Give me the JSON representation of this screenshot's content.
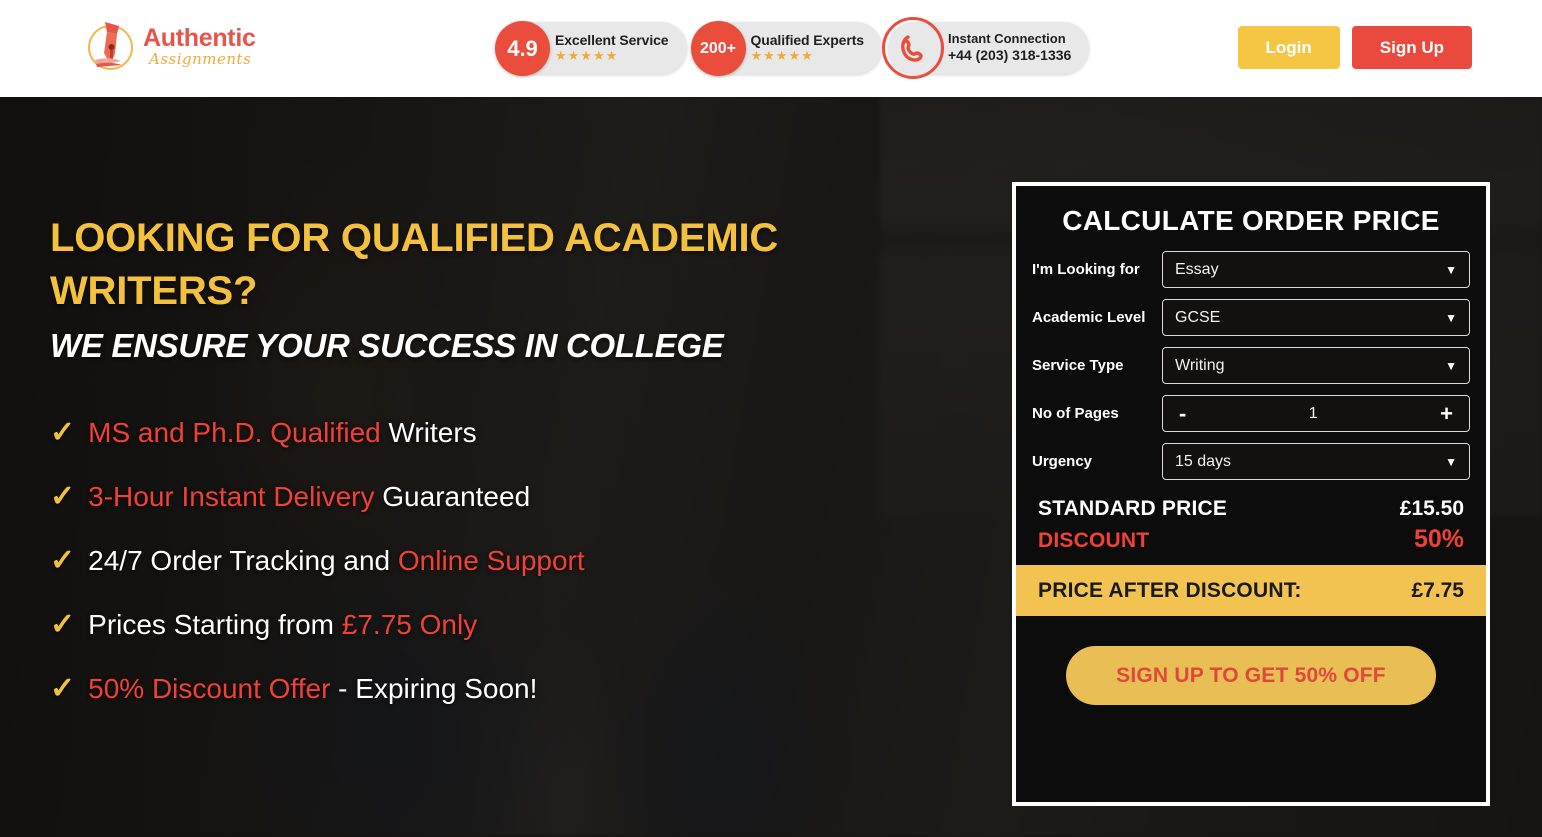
{
  "brand": {
    "name_top": "Authentic",
    "name_bottom": "Assignments",
    "logo_icon": "fountain-pen-nib-icon",
    "accent_red": "#e8544a",
    "accent_gold": "#f0a93c"
  },
  "header": {
    "badges": [
      {
        "circle": "4.9",
        "title": "Excellent Service",
        "stars": "★★★★★",
        "circle_color": "#eb4d3d"
      },
      {
        "circle": "200+",
        "title": "Qualified Experts",
        "stars": "★★★★★",
        "circle_color": "#eb4d3d"
      }
    ],
    "phone_badge": {
      "icon": "phone-handset-icon",
      "line1": "Instant Connection",
      "line2": "+44 (203) 318-1336"
    },
    "login_label": "Login",
    "signup_label": "Sign Up",
    "login_color": "#f5c544",
    "signup_color": "#ea4a3d"
  },
  "hero": {
    "headline_line1": "LOOKING FOR QUALIFIED ACADEMIC",
    "headline_line2": "WRITERS?",
    "subheadline": "WE ENSURE YOUR SUCCESS IN COLLEGE",
    "headline_color": "#f3c13e",
    "bullets": [
      {
        "check": "✓",
        "highlight": "MS and Ph.D. Qualified",
        "plain": " Writers",
        "highlight_first": true
      },
      {
        "check": "✓",
        "highlight": "3-Hour Instant Delivery",
        "plain": " Guaranteed",
        "highlight_first": true
      },
      {
        "check": "✓",
        "plain": "24/7 Order Tracking and ",
        "highlight": "Online Support",
        "highlight_first": false
      },
      {
        "check": "✓",
        "plain": "Prices Starting from ",
        "highlight": "£7.75 Only",
        "highlight_first": false
      },
      {
        "check": "✓",
        "highlight": "50% Discount Offer",
        "plain": " - Expiring Soon!",
        "highlight_first": true
      }
    ],
    "highlight_color": "#ef4136"
  },
  "calculator": {
    "title": "CALCULATE ORDER PRICE",
    "fields": [
      {
        "label": "I'm Looking for",
        "value": "Essay",
        "type": "select"
      },
      {
        "label": "Academic Level",
        "value": "GCSE",
        "type": "select"
      },
      {
        "label": "Service Type",
        "value": "Writing",
        "type": "select"
      },
      {
        "label": "No of Pages",
        "value": "1",
        "type": "stepper",
        "minus": "-",
        "plus": "+"
      },
      {
        "label": "Urgency",
        "value": "15 days",
        "type": "select"
      }
    ],
    "standard_price_label": "STANDARD PRICE",
    "standard_price_value": "£15.50",
    "discount_label": "DISCOUNT",
    "discount_value": "50%",
    "after_discount_label": "PRICE AFTER DISCOUNT:",
    "after_discount_value": "£7.75",
    "cta_label": "SIGN UP TO GET 50% OFF",
    "cta_bg": "#e9be55",
    "cta_text_color": "#e1483c",
    "after_bar_bg": "#f3c352"
  }
}
